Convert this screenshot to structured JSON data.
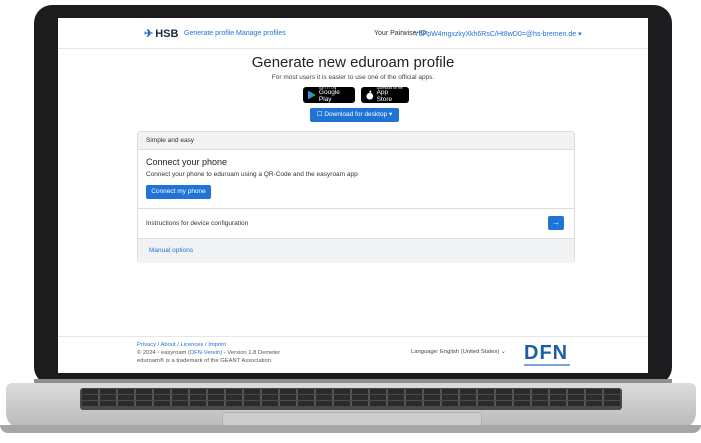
{
  "header": {
    "logo_text": "HSB",
    "nav": [
      "Generate profile",
      "Manage profiles"
    ],
    "pairwise_label": "Your Pairwise-ID:",
    "pairwise_value": "Y5PpW4mgxzkyXkh6RsC/Ht8wD0=@hs-bremen.de ▾"
  },
  "main": {
    "title": "Generate new eduroam profile",
    "subtitle": "For most users it is easier to use one of the official apps.",
    "google_play_small": "GET IT ON",
    "google_play": "Google Play",
    "app_store_small": "Download on the",
    "app_store": "App Store",
    "download_button": "☐ Download for desktop ▾"
  },
  "card": {
    "header": "Simple and easy",
    "connect_title": "Connect your phone",
    "connect_text": "Connect your phone to eduroam using a QR-Code and the easyroam app",
    "connect_button": "Connect my phone",
    "instructions": "Instructions for device configuration",
    "arrow": "→",
    "manual": "Manual options"
  },
  "footer": {
    "links": "Privacy / About / Licences / Imprint",
    "line2_prefix": "© 2024 - easyroam (",
    "line2_link": "DFN-Verein",
    "line2_suffix": ") - Version 1.8 Demeter",
    "line3": "eduroam® is a trademark of the GEANT Association.",
    "language": "Language:  English (United States)  ⌄",
    "dfn_logo": "DFN"
  },
  "colors": {
    "accent": "#1f74d6",
    "frame": "#1c1c1e"
  }
}
